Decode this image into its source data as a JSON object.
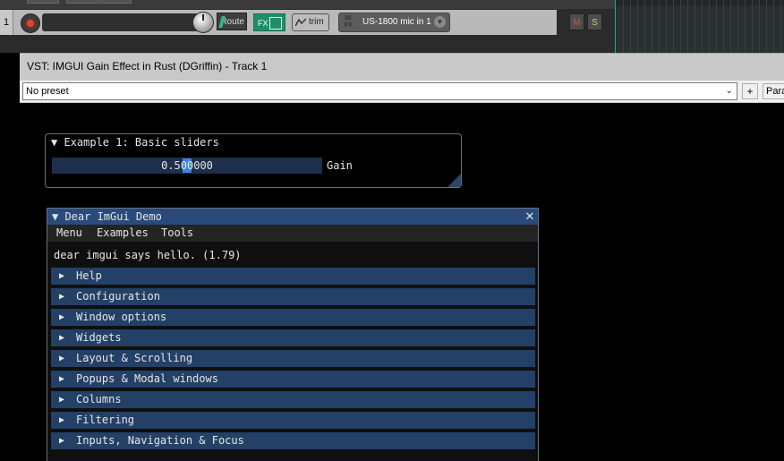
{
  "reaper": {
    "track_number": "1",
    "route_label": "Route",
    "fx_label": "FX",
    "trim_label": "trim",
    "input_prefix": "IN FX",
    "input_label": "US-1800 mic in 1",
    "mute_label": "M",
    "solo_label": "S"
  },
  "plugin_window": {
    "title": "VST: IMGUI Gain Effect in Rust (DGriffin) - Track 1",
    "preset_value": "No preset",
    "plus_label": "+",
    "param_label": "Param"
  },
  "example1": {
    "title": "▼ Example 1: Basic sliders",
    "slider_value": "0.500000",
    "gain_fraction": 0.5,
    "slider_label": "Gain"
  },
  "demo": {
    "title": "▼ Dear ImGui Demo",
    "close_glyph": "✕",
    "menu": [
      "Menu",
      "Examples",
      "Tools"
    ],
    "hello_text": "dear imgui says hello. (1.79)",
    "sections": [
      "Help",
      "Configuration",
      "Window options",
      "Widgets",
      "Layout & Scrolling",
      "Popups & Modal windows",
      "Columns",
      "Filtering",
      "Inputs, Navigation & Focus"
    ]
  },
  "colors": {
    "imgui_header": "#234066",
    "imgui_title_active": "#294a7a",
    "fx_green": "#1f8e6b"
  }
}
